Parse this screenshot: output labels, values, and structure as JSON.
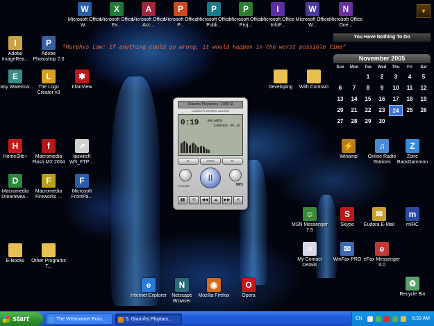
{
  "desktop": {
    "quote": "\"Murphys Law: If anything could go wrong, it would happen in the worst possible time\"",
    "widget_title": "You Have Nothing To Do",
    "top_icons": [
      {
        "label": "Microsoft Office W...",
        "icon": "word-icon",
        "color": "#2a5caa",
        "glyph": "W"
      },
      {
        "label": "Microsoft Office Ex...",
        "icon": "excel-icon",
        "color": "#1f7a3a",
        "glyph": "X"
      },
      {
        "label": "Microsoft Office Acc...",
        "icon": "access-icon",
        "color": "#a0263a",
        "glyph": "A"
      },
      {
        "label": "Microsoft Office P...",
        "icon": "powerpoint-icon",
        "color": "#c84b1f",
        "glyph": "P"
      },
      {
        "label": "Microsoft Office Publi...",
        "icon": "publisher-icon",
        "color": "#1b7a8a",
        "glyph": "P"
      },
      {
        "label": "Microsoft Office Proj...",
        "icon": "project-icon",
        "color": "#2e7d32",
        "glyph": "P"
      },
      {
        "label": "Microsoft Office InfoP...",
        "icon": "infopath-icon",
        "color": "#5a2ea6",
        "glyph": "I"
      },
      {
        "label": "Microsoft Office W...",
        "icon": "word-icon",
        "color": "#4a3aa0",
        "glyph": "W"
      },
      {
        "label": "Microsoft Office One...",
        "icon": "onenote-icon",
        "color": "#6a2ea0",
        "glyph": "N"
      }
    ],
    "left_icons": [
      {
        "label": "Adobe ImageRea...",
        "icon": "imageready-icon",
        "color": "#c9a34a",
        "glyph": "I"
      },
      {
        "label": "Adobe Photoshop 7.0",
        "icon": "photoshop-icon",
        "color": "#3a5fa0",
        "glyph": "P"
      },
      {
        "label": "Easy Waterma...",
        "icon": "easy-watermark-icon",
        "color": "#3a8a8a",
        "glyph": "E"
      },
      {
        "label": "The Logo Creator v3",
        "icon": "logo-creator-icon",
        "color": "#d8a020",
        "glyph": "L"
      },
      {
        "label": "IrfanView",
        "icon": "irfanview-icon",
        "color": "#c01818",
        "glyph": "✱"
      },
      {
        "label": "HomeSite+",
        "icon": "homesite-icon",
        "color": "#c81818",
        "glyph": "H"
      },
      {
        "label": "Macromedia Flash MX 2004",
        "icon": "flash-icon",
        "color": "#b51818",
        "glyph": "f"
      },
      {
        "label": "Ipswitch WS_FTP ...",
        "icon": "ws-ftp-icon",
        "color": "#d0d0d0",
        "glyph": "↗"
      },
      {
        "label": "Macromedia Dreamwea...",
        "icon": "dreamweaver-icon",
        "color": "#2a8a3a",
        "glyph": "D"
      },
      {
        "label": "Macromedia Fireworks ...",
        "icon": "fireworks-icon",
        "color": "#b8a018",
        "glyph": "F"
      },
      {
        "label": "Microsoft FrontPa...",
        "icon": "frontpage-icon",
        "color": "#2a5caa",
        "glyph": "F"
      },
      {
        "label": "E-Books",
        "icon": "folder-icon",
        "color": "#e8c050",
        "glyph": ""
      },
      {
        "label": "Other Programs T...",
        "icon": "folder-icon",
        "color": "#e8c050",
        "glyph": ""
      }
    ],
    "right_icons": [
      {
        "label": "Developing",
        "icon": "folder-icon",
        "color": "#e8c050",
        "glyph": ""
      },
      {
        "label": "With Contract",
        "icon": "folder-icon",
        "color": "#e8c050",
        "glyph": ""
      },
      {
        "label": "Winamp",
        "icon": "winamp-icon",
        "color": "#b8801a",
        "glyph": "⚡"
      },
      {
        "label": "Online Radio Stations",
        "icon": "radio-icon",
        "color": "#4a8ad0",
        "glyph": "♫"
      },
      {
        "label": "Zone BackGammon",
        "icon": "zone-icon",
        "color": "#3a8ad8",
        "glyph": "Z"
      },
      {
        "label": "MSN Messenger 7.5",
        "icon": "msn-icon",
        "color": "#3a8a3a",
        "glyph": "☺"
      },
      {
        "label": "Skype",
        "icon": "skype-icon",
        "color": "#c01818",
        "glyph": "S"
      },
      {
        "label": "Eudora E-Mail",
        "icon": "eudora-icon",
        "color": "#c8a030",
        "glyph": "✉"
      },
      {
        "label": "mIRC",
        "icon": "mirc-icon",
        "color": "#2a4aa0",
        "glyph": "m"
      },
      {
        "label": "My Contact Details",
        "icon": "contact-details-icon",
        "color": "#d8d8e8",
        "glyph": "≡"
      },
      {
        "label": "WinFax PRO",
        "icon": "winfax-icon",
        "color": "#3a6ab8",
        "glyph": "✉"
      },
      {
        "label": "eFax Messenger 4.0",
        "icon": "efax-icon",
        "color": "#c03a3a",
        "glyph": "e"
      },
      {
        "label": "Recycle Bin",
        "icon": "recycle-bin-icon",
        "color": "#5aa06a",
        "glyph": "♻"
      }
    ],
    "bottom_icons": [
      {
        "label": "Internet Explorer",
        "icon": "internet-explorer-icon",
        "color": "#2a7ad8",
        "glyph": "e"
      },
      {
        "label": "Netscape Browser",
        "icon": "netscape-icon",
        "color": "#2a6a7a",
        "glyph": "N"
      },
      {
        "label": "Mozilla Firefox",
        "icon": "firefox-icon",
        "color": "#d86a1a",
        "glyph": "◉"
      },
      {
        "label": "Opera",
        "icon": "opera-icon",
        "color": "#c81818",
        "glyph": "O"
      }
    ]
  },
  "calendar": {
    "month": "November 2005",
    "weekdays": [
      "Sun",
      "Mon",
      "Tue",
      "Wed",
      "Thu",
      "Fri",
      "Sat"
    ],
    "days": [
      "",
      "",
      "1",
      "2",
      "3",
      "4",
      "5",
      "6",
      "7",
      "8",
      "9",
      "10",
      "11",
      "12",
      "13",
      "14",
      "15",
      "16",
      "17",
      "18",
      "19",
      "20",
      "21",
      "22",
      "23",
      "24",
      "25",
      "26",
      "27",
      "28",
      "29",
      "30",
      "",
      "",
      ""
    ],
    "today": "24"
  },
  "player": {
    "title": "Giannhs Ploytarxos - 1000 (3",
    "subtitle": "LOOKUPS STEREO 44.1KHZ",
    "time": "0:19",
    "balance_label": "BALANCE",
    "bits": "128kbps 44.1k",
    "btn_fl": "FL",
    "btn_open": "OPEN",
    "btn_pl": "PL",
    "mp3_label": "MP3",
    "volume_label": "VOLUME",
    "play_symbol": "II",
    "controls": [
      "▮▮",
      "⟲",
      "◀◀",
      "▲",
      "▶▶",
      "✕"
    ]
  },
  "taskbar": {
    "start_label": "start",
    "tasks": [
      {
        "label": "The Webmaster Foru...",
        "icon": "internet-explorer-icon",
        "color": "#4a9ae0"
      },
      {
        "label": "5. Giannhs Ploytarx...",
        "icon": "winamp-icon",
        "color": "#d08a1a"
      }
    ],
    "lang": "EN",
    "clock": "6:33 AM"
  }
}
